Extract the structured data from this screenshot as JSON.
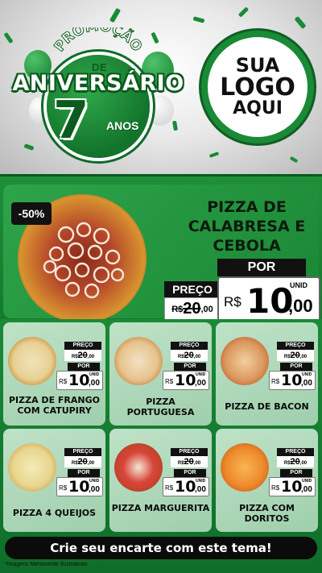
{
  "header": {
    "promo_text": "PROMOÇÃO",
    "de_text": "DE",
    "aniversario_text": "ANIVERSÁRIO",
    "years_number": "7",
    "years_text": "ANOS",
    "logo_line1": "SUA",
    "logo_line2": "LOGO",
    "logo_line3": "AQUI"
  },
  "featured": {
    "discount": "-50%",
    "title": "PIZZA DE CALABRESA E CEBOLA",
    "por_label": "POR",
    "preco_label": "PREÇO",
    "old_currency": "R$",
    "old_price": "20",
    "old_cents": ",00",
    "new_currency": "R$",
    "new_price": "10",
    "new_cents": ",00",
    "unit": "UNID"
  },
  "products": [
    {
      "name": "PIZZA DE FRANGO COM CATUPIRY",
      "preco_label": "PREÇO",
      "old_currency": "R$",
      "old_price": "20",
      "old_cents": ",00",
      "por_label": "POR",
      "new_currency": "R$",
      "new_price": "10",
      "new_cents": ",00",
      "unit": "UNID"
    },
    {
      "name": "PIZZA PORTUGUESA",
      "preco_label": "PREÇO",
      "old_currency": "R$",
      "old_price": "20",
      "old_cents": ",00",
      "por_label": "POR",
      "new_currency": "R$",
      "new_price": "10",
      "new_cents": ",00",
      "unit": "UNID"
    },
    {
      "name": "PIZZA DE BACON",
      "preco_label": "PREÇO",
      "old_currency": "R$",
      "old_price": "20",
      "old_cents": ",00",
      "por_label": "POR",
      "new_currency": "R$",
      "new_price": "10",
      "new_cents": ",00",
      "unit": "UNID"
    },
    {
      "name": "PIZZA 4 QUEIJOS",
      "preco_label": "PREÇO",
      "old_currency": "R$",
      "old_price": "20",
      "old_cents": ",00",
      "por_label": "POR",
      "new_currency": "R$",
      "new_price": "10",
      "new_cents": ",00",
      "unit": "UNID"
    },
    {
      "name": "PIZZA MARGUERITA",
      "preco_label": "PREÇO",
      "old_currency": "R$",
      "old_price": "20",
      "old_cents": ",00",
      "por_label": "POR",
      "new_currency": "R$",
      "new_price": "10",
      "new_cents": ",00",
      "unit": "UNID"
    },
    {
      "name": "PIZZA COM DORITOS",
      "preco_label": "PREÇO",
      "old_currency": "R$",
      "old_price": "20",
      "old_cents": ",00",
      "por_label": "POR",
      "new_currency": "R$",
      "new_price": "10",
      "new_cents": ",00",
      "unit": "UNID"
    }
  ],
  "footer": {
    "cta_text": "Crie seu encarte com este tema!",
    "disclaimer": "*Imagens Meramente Ilustrativas"
  },
  "colors": {
    "brand_green": "#1a8a36",
    "dark_green": "#0b5a1f",
    "card_green": "#bfe2c7",
    "black": "#111111"
  }
}
